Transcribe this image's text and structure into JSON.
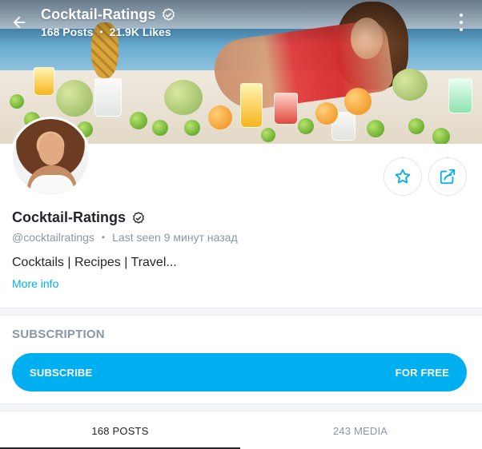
{
  "header": {
    "title": "Cocktail-Ratings",
    "posts": "168 Posts",
    "likes": "21.9K Likes"
  },
  "profile": {
    "name": "Cocktail-Ratings",
    "handle": "@cocktailratings",
    "last_seen": "Last seen 9 минут назад",
    "bio": "Cocktails | Recipes | Travel...",
    "more_info": "More info"
  },
  "subscription": {
    "label": "SUBSCRIPTION",
    "button_left": "SUBSCRIBE",
    "button_right": "FOR FREE"
  },
  "tabs": [
    {
      "label": "168 POSTS",
      "active": true
    },
    {
      "label": "243 MEDIA",
      "active": false
    }
  ],
  "icons": {
    "back": "arrow-left-icon",
    "verified": "verified-check-icon",
    "more": "vertical-dots-icon",
    "favorite": "star-icon",
    "share": "share-icon"
  },
  "colors": {
    "accent": "#00aff0",
    "text_primary": "#242529",
    "text_muted": "#8a96a3"
  }
}
